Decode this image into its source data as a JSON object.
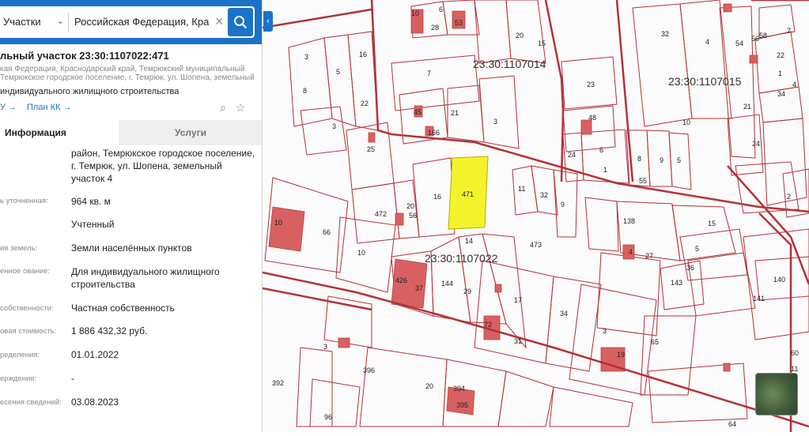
{
  "search": {
    "type_label": "Участки",
    "query": "Российская Федерация, Крас"
  },
  "card": {
    "title": "льный участок 23:30:1107022:471",
    "address_lines": [
      "кая Федерация, Краснодарский край, Темрюкский муниципальный",
      "Темрюкское городское поселение, г. Темрюк, ул. Шопена, земельный"
    ],
    "purpose": "индивидуального жилищного строительства",
    "link1": "У →",
    "link2": "План КК →"
  },
  "tabs": {
    "info": "Информация",
    "services": "Услуги"
  },
  "details": [
    {
      "label": "",
      "value": "район, Темрюкское городское поселение, г. Темрюк, ул. Шопена, земельный участок 4"
    },
    {
      "label": "ь уточненная:",
      "value": "964 кв. м"
    },
    {
      "label": "",
      "value": "Учтенный"
    },
    {
      "label": "ия земель:",
      "value": "Земли населённых пунктов"
    },
    {
      "label": "енное ование:",
      "value": "Для индивидуального жилищного строительства"
    },
    {
      "label": "собственности:",
      "value": "Частная собственность"
    },
    {
      "label": "овая стоимость:",
      "value": "1 886 432,32 руб."
    },
    {
      "label": "ределения:",
      "value": "01.01.2022"
    },
    {
      "label": "ерждения:",
      "value": "-"
    },
    {
      "label": "есения сведений:",
      "value": "03.08.2023"
    }
  ],
  "map": {
    "quarter_labels": [
      "23:30:1107014",
      "23:30:1107015",
      "23:30:1107022"
    ],
    "parcel_numbers": [
      "10",
      "28",
      "6",
      "53",
      "20",
      "15",
      "32",
      "4",
      "54",
      "56",
      "58",
      "7",
      "3",
      "16",
      "5",
      "22",
      "1",
      "8",
      "7",
      "23",
      "34",
      "4",
      "45",
      "21",
      "3",
      "22",
      "48",
      "10",
      "21",
      "3",
      "166",
      "25",
      "24",
      "6",
      "8",
      "9",
      "5",
      "24",
      "1",
      "55",
      "2",
      "471",
      "16",
      "11",
      "32",
      "9",
      "472",
      "20",
      "56",
      "138",
      "15",
      "10",
      "66",
      "10",
      "14",
      "473",
      "4",
      "5",
      "36",
      "140",
      "426",
      "37",
      "144",
      "29",
      "27",
      "143",
      "141",
      "17",
      "34",
      "72",
      "3",
      "65",
      "31",
      "3",
      "396",
      "392",
      "20",
      "394",
      "395",
      "96",
      "19",
      "60",
      "11",
      "64"
    ],
    "colors": {
      "boundary": "#b3313a",
      "selected": "#f4f22a",
      "building": "#d96060"
    }
  }
}
